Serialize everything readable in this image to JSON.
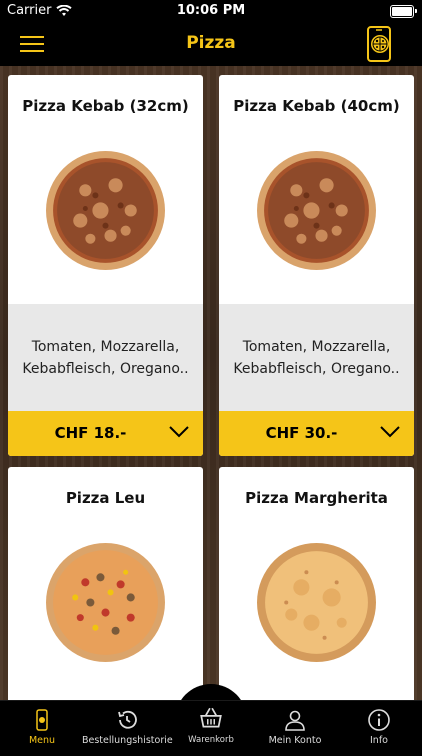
{
  "status_bar": {
    "carrier": "Carrier",
    "time": "10:06 PM"
  },
  "header": {
    "title": "Pizza"
  },
  "products": [
    {
      "name": "Pizza Kebab (32cm)",
      "description": "Tomaten, Mozzarella, Kebabfleisch, Oregano..",
      "price": "CHF 18.-"
    },
    {
      "name": "Pizza Kebab (40cm)",
      "description": "Tomaten, Mozzarella, Kebabfleisch, Oregano..",
      "price": "CHF 30.-"
    },
    {
      "name": "Pizza Leu"
    },
    {
      "name": "Pizza Margherita"
    }
  ],
  "tabs": [
    {
      "label": "Menu",
      "icon": "phone-icon"
    },
    {
      "label": "Bestellungshistorie",
      "icon": "history-icon"
    },
    {
      "label": "Warenkorb",
      "icon": "basket-icon"
    },
    {
      "label": "Mein Konto",
      "icon": "user-icon"
    },
    {
      "label": "Info",
      "icon": "info-icon"
    }
  ],
  "colors": {
    "accent": "#f5c518",
    "background": "#000000"
  }
}
